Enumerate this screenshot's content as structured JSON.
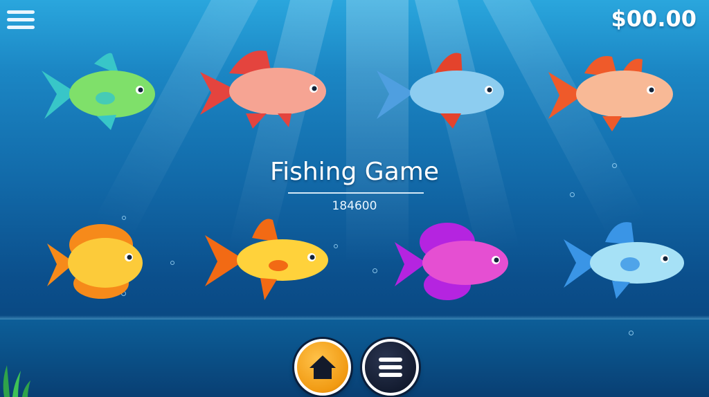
{
  "header": {
    "menu_icon": "hamburger-menu-icon",
    "balance": "$00.00"
  },
  "title": {
    "text": "Fishing Game",
    "subtitle": "184600"
  },
  "fish": [
    {
      "name": "green-fish",
      "row": 1,
      "body": "#7fe06a",
      "fin": "#38c6c8"
    },
    {
      "name": "red-coral-fish",
      "row": 1,
      "body": "#f6a493",
      "fin": "#e4443e"
    },
    {
      "name": "blue-fish",
      "row": 1,
      "body": "#8dcdf0",
      "fin": "#e4432c"
    },
    {
      "name": "peach-fish",
      "row": 1,
      "body": "#f8b996",
      "fin": "#ef5a2a"
    },
    {
      "name": "orange-round-fish",
      "row": 2,
      "body": "#fccb3a",
      "fin": "#f68a1a"
    },
    {
      "name": "yellow-fish",
      "row": 2,
      "body": "#ffd23b",
      "fin": "#f26a14"
    },
    {
      "name": "magenta-fish",
      "row": 2,
      "body": "#e54fd2",
      "fin": "#b524e0"
    },
    {
      "name": "light-blue-fish",
      "row": 2,
      "body": "#a6e1f6",
      "fin": "#3a95e6"
    }
  ],
  "bottom_bar": {
    "home_icon": "home-icon",
    "menu_icon": "menu-icon"
  },
  "colors": {
    "water_top": "#2aa6dd",
    "water_bottom": "#083e72",
    "home_button": "#f19a12",
    "menu_button": "#121a2e"
  }
}
